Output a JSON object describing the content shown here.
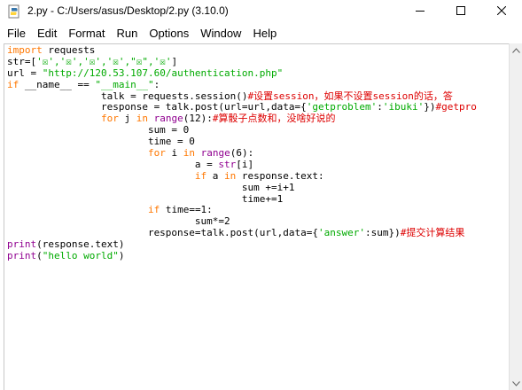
{
  "window": {
    "title": "2.py - C:/Users/asus/Desktop/2.py (3.10.0)",
    "app_icon": "python-file-icon",
    "controls": {
      "minimize_icon": "minimize-icon",
      "maximize_icon": "maximize-icon",
      "close_icon": "close-icon"
    }
  },
  "menubar": {
    "items": [
      {
        "label": "File"
      },
      {
        "label": "Edit"
      },
      {
        "label": "Format"
      },
      {
        "label": "Run"
      },
      {
        "label": "Options"
      },
      {
        "label": "Window"
      },
      {
        "label": "Help"
      }
    ]
  },
  "editor": {
    "colors": {
      "keyword": "#ff7700",
      "builtin": "#900090",
      "string": "#00aa00",
      "comment": "#dd0000",
      "text": "#000000"
    },
    "lines": [
      [
        {
          "t": "import",
          "c": "kw"
        },
        {
          "t": " requests"
        }
      ],
      [
        {
          "t": "str=["
        },
        {
          "t": "'☒','☒','☒','☒',\"☒\",'☒'",
          "c": "st"
        },
        {
          "t": "]"
        }
      ],
      [
        {
          "t": "url = "
        },
        {
          "t": "\"http://120.53.107.60/authentication.php\"",
          "c": "st"
        }
      ],
      [
        {
          "t": "if",
          "c": "kw"
        },
        {
          "t": " __name__ == "
        },
        {
          "t": "\"__main__\"",
          "c": "st"
        },
        {
          "t": ":"
        }
      ],
      [
        {
          "t": "                talk = requests.session()"
        },
        {
          "t": "#设置session，如果不设置session的话，答",
          "c": "cm"
        }
      ],
      [
        {
          "t": "                response = talk.post(url=url,data={"
        },
        {
          "t": "'getproblem'",
          "c": "st"
        },
        {
          "t": ":"
        },
        {
          "t": "'ibuki'",
          "c": "st"
        },
        {
          "t": "})"
        },
        {
          "t": "#getpro",
          "c": "cm"
        }
      ],
      [
        {
          "t": "                "
        },
        {
          "t": "for",
          "c": "kw"
        },
        {
          "t": " j "
        },
        {
          "t": "in",
          "c": "kw"
        },
        {
          "t": " "
        },
        {
          "t": "range",
          "c": "bi"
        },
        {
          "t": "(12):"
        },
        {
          "t": "#算骰子点数和，没啥好说的",
          "c": "cm"
        }
      ],
      [
        {
          "t": "                        sum = 0"
        }
      ],
      [
        {
          "t": "                        time = 0"
        }
      ],
      [
        {
          "t": "                        "
        },
        {
          "t": "for",
          "c": "kw"
        },
        {
          "t": " i "
        },
        {
          "t": "in",
          "c": "kw"
        },
        {
          "t": " "
        },
        {
          "t": "range",
          "c": "bi"
        },
        {
          "t": "(6):"
        }
      ],
      [
        {
          "t": "                                a = "
        },
        {
          "t": "str",
          "c": "bi"
        },
        {
          "t": "[i]"
        }
      ],
      [
        {
          "t": "                                "
        },
        {
          "t": "if",
          "c": "kw"
        },
        {
          "t": " a "
        },
        {
          "t": "in",
          "c": "kw"
        },
        {
          "t": " response.text:"
        }
      ],
      [
        {
          "t": "                                        sum +=i+1"
        }
      ],
      [
        {
          "t": "                                        time+=1"
        }
      ],
      [
        {
          "t": "                        "
        },
        {
          "t": "if",
          "c": "kw"
        },
        {
          "t": " time==1:"
        }
      ],
      [
        {
          "t": "                                sum*=2"
        }
      ],
      [
        {
          "t": "                        response=talk.post(url,data={"
        },
        {
          "t": "'answer'",
          "c": "st"
        },
        {
          "t": ":sum})"
        },
        {
          "t": "#提交计算结果",
          "c": "cm"
        }
      ],
      [
        {
          "t": "print",
          "c": "bi"
        },
        {
          "t": "(response.text)"
        }
      ],
      [
        {
          "t": "print",
          "c": "bi"
        },
        {
          "t": "("
        },
        {
          "t": "\"hello world\"",
          "c": "st"
        },
        {
          "t": ")"
        }
      ]
    ]
  },
  "scrollbar": {
    "up_icon": "scroll-up-arrow-icon",
    "down_icon": "scroll-down-arrow-icon"
  }
}
